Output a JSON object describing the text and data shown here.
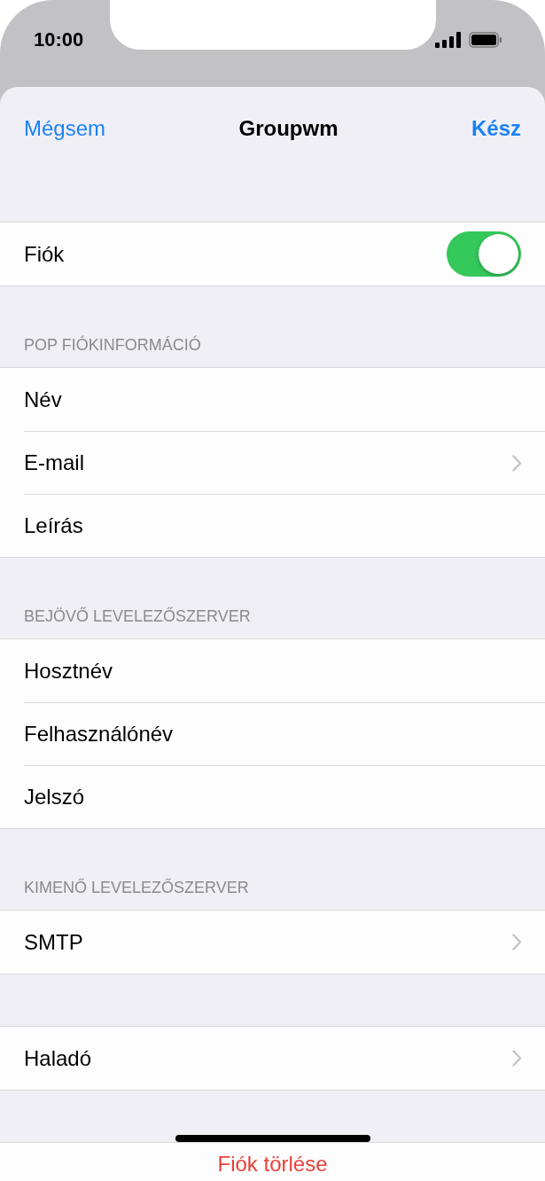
{
  "status_bar": {
    "time": "10:00"
  },
  "nav": {
    "cancel": "Mégsem",
    "title": "Groupwm",
    "done": "Kész"
  },
  "sections": [
    {
      "rows": [
        {
          "label": "Fiók",
          "kind": "toggle",
          "on": true
        }
      ]
    },
    {
      "header": "POP FIÓKINFORMÁCIÓ",
      "rows": [
        {
          "label": "Név",
          "kind": "plain"
        },
        {
          "label": "E-mail",
          "kind": "chevron"
        },
        {
          "label": "Leírás",
          "kind": "plain"
        }
      ]
    },
    {
      "header": "BEJÖVŐ LEVELEZŐSZERVER",
      "rows": [
        {
          "label": "Hosztnév",
          "kind": "plain"
        },
        {
          "label": "Felhasználónév",
          "kind": "plain"
        },
        {
          "label": "Jelszó",
          "kind": "plain"
        }
      ]
    },
    {
      "header": "KIMENŐ LEVELEZŐSZERVER",
      "rows": [
        {
          "label": "SMTP",
          "kind": "chevron"
        }
      ]
    },
    {
      "rows": [
        {
          "label": "Haladó",
          "kind": "chevron"
        }
      ]
    }
  ],
  "delete_button": "Fiók törlése"
}
